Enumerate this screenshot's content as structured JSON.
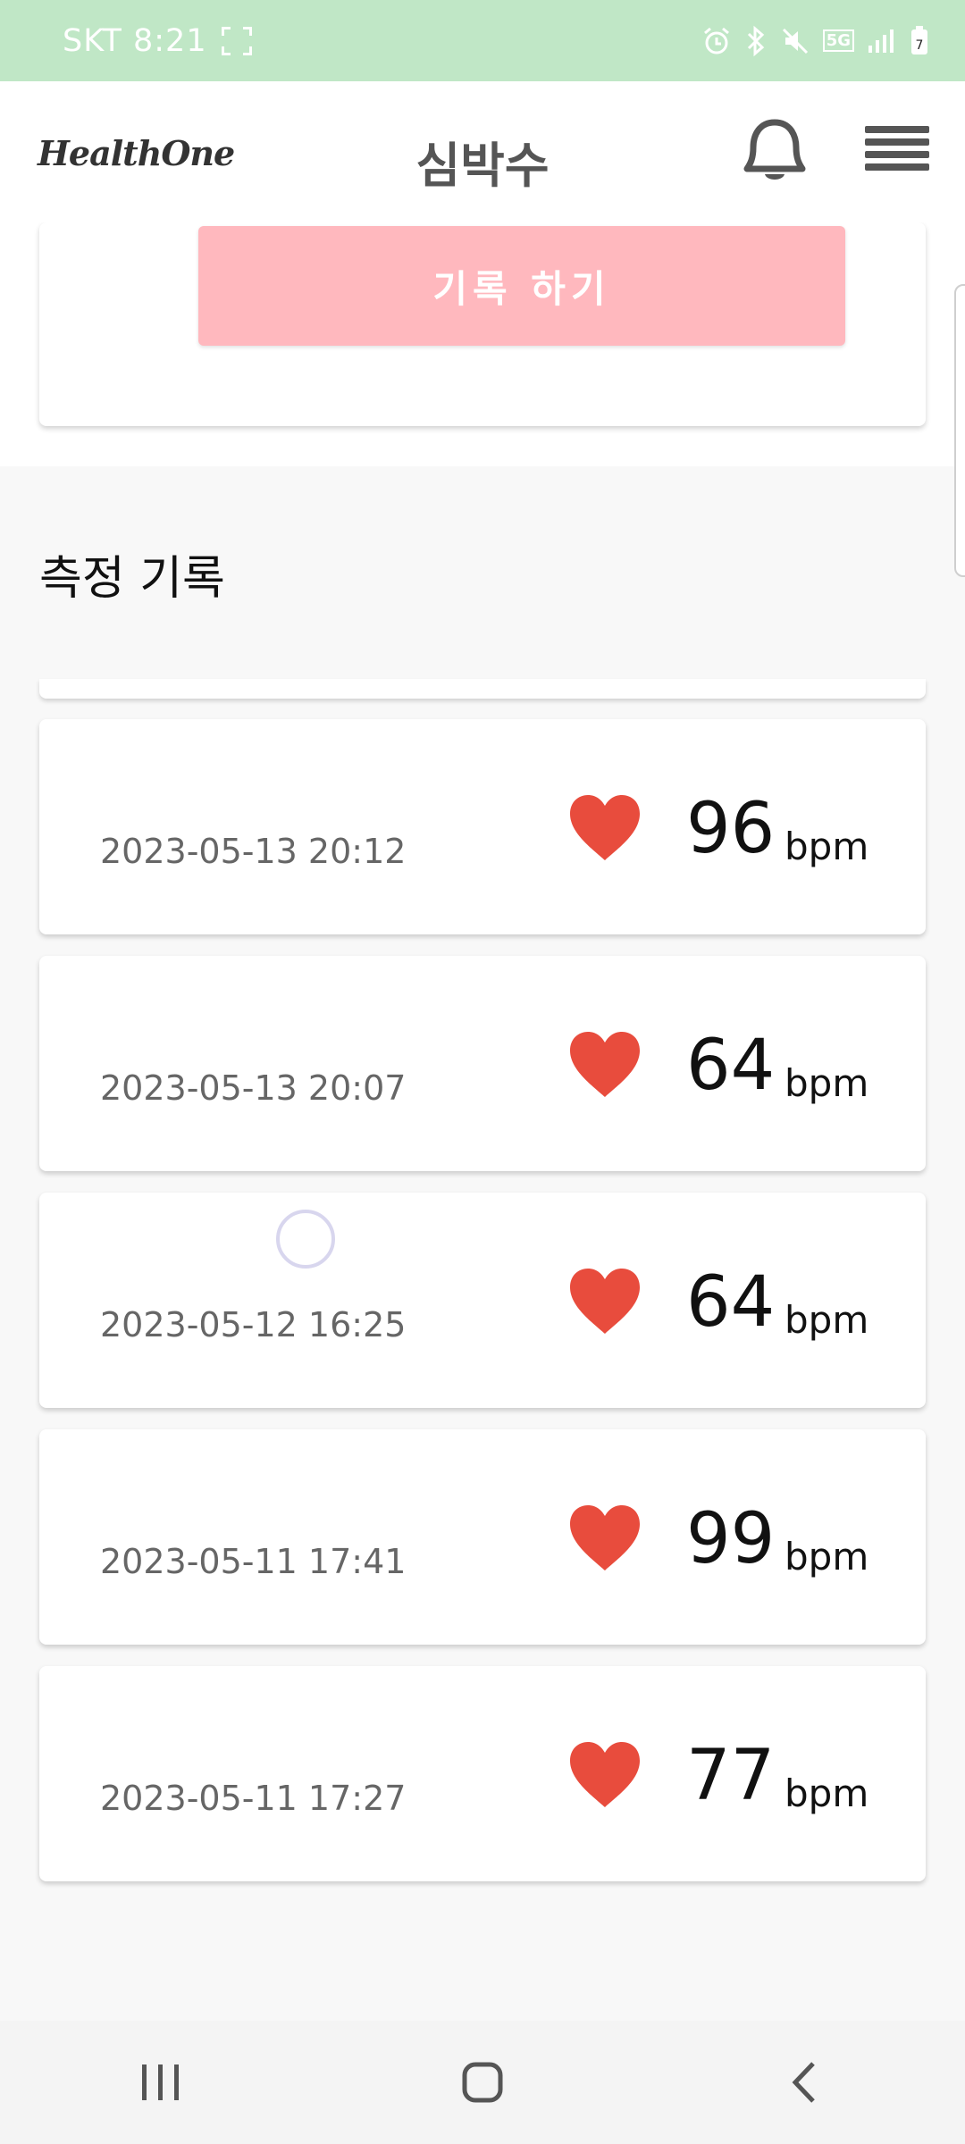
{
  "status_bar": {
    "carrier": "SKT",
    "time": "8:21",
    "network": "5G"
  },
  "header": {
    "logo": "HealthOne",
    "title": "심박수"
  },
  "record_button_label": "기록 하기",
  "section_title": "측정 기록",
  "records": [
    {
      "date": "2023-05-13 20:12",
      "value": "96",
      "unit": "bpm"
    },
    {
      "date": "2023-05-13 20:07",
      "value": "64",
      "unit": "bpm"
    },
    {
      "date": "2023-05-12 16:25",
      "value": "64",
      "unit": "bpm"
    },
    {
      "date": "2023-05-11 17:41",
      "value": "99",
      "unit": "bpm"
    },
    {
      "date": "2023-05-11 17:27",
      "value": "77",
      "unit": "bpm"
    }
  ],
  "colors": {
    "status_bar": "#c0e7c6",
    "record_button": "#ffb8be",
    "heart": "#e84c3d"
  }
}
